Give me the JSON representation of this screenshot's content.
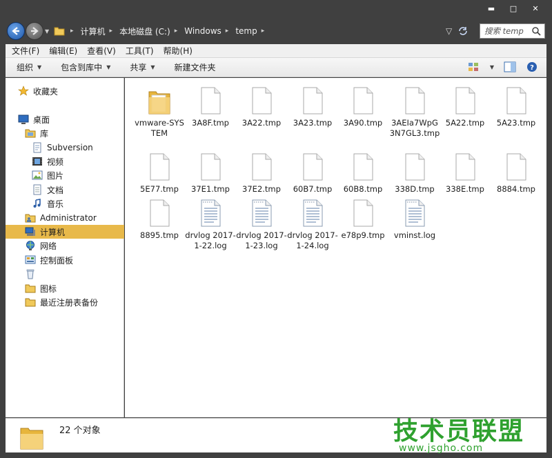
{
  "window": {
    "min_glyph": "▬",
    "max_glyph": "□",
    "close_glyph": "✕"
  },
  "address": {
    "crumbs": [
      "计算机",
      "本地磁盘 (C:)",
      "Windows",
      "temp"
    ],
    "search_placeholder": "搜索 temp"
  },
  "menu": [
    "文件(F)",
    "编辑(E)",
    "查看(V)",
    "工具(T)",
    "帮助(H)"
  ],
  "toolbar": {
    "organize": "组织",
    "include": "包含到库中",
    "share": "共享",
    "new_folder": "新建文件夹"
  },
  "sidebar": {
    "favorites": "收藏夹",
    "desktop": "桌面",
    "libraries": "库",
    "subversion": "Subversion",
    "videos": "视频",
    "pictures": "图片",
    "documents": "文档",
    "music": "音乐",
    "administrator": "Administrator",
    "computer": "计算机",
    "network": "网络",
    "control_panel": "控制面板",
    "recycle_bin": "",
    "icons_folder": "图标",
    "recent_backup": "最近注册表备份"
  },
  "files": [
    {
      "name": "vmware-SYSTEM",
      "icon": "folder-icon"
    },
    {
      "name": "3A8F.tmp",
      "icon": "file-icon"
    },
    {
      "name": "3A22.tmp",
      "icon": "file-icon"
    },
    {
      "name": "3A23.tmp",
      "icon": "file-icon"
    },
    {
      "name": "3A90.tmp",
      "icon": "file-icon"
    },
    {
      "name": "3AEIa7WpG3N7GL3.tmp",
      "icon": "file-icon"
    },
    {
      "name": "5A22.tmp",
      "icon": "file-icon"
    },
    {
      "name": "5A23.tmp",
      "icon": "file-icon"
    },
    {
      "name": "5E77.tmp",
      "icon": "file-icon"
    },
    {
      "name": "37E1.tmp",
      "icon": "file-icon"
    },
    {
      "name": "37E2.tmp",
      "icon": "file-icon"
    },
    {
      "name": "60B7.tmp",
      "icon": "file-icon"
    },
    {
      "name": "60B8.tmp",
      "icon": "file-icon"
    },
    {
      "name": "338D.tmp",
      "icon": "file-icon"
    },
    {
      "name": "338E.tmp",
      "icon": "file-icon"
    },
    {
      "name": "8884.tmp",
      "icon": "file-icon"
    },
    {
      "name": "8895.tmp",
      "icon": "file-icon"
    },
    {
      "name": "drvlog 2017-1-22.log",
      "icon": "log-icon"
    },
    {
      "name": "drvlog 2017-1-23.log",
      "icon": "log-icon"
    },
    {
      "name": "drvlog 2017-1-24.log",
      "icon": "log-icon"
    },
    {
      "name": "e78p9.tmp",
      "icon": "file-icon"
    },
    {
      "name": "vminst.log",
      "icon": "log-icon"
    }
  ],
  "status": {
    "count_text": "22 个对象"
  },
  "watermark": {
    "big": "技术员联盟",
    "small": "www.jsgho.com"
  },
  "colors": {
    "selection": "#e8b94a",
    "folder": "#f0c95a",
    "chrome": "#404040",
    "watermark": "#2fa12f"
  }
}
